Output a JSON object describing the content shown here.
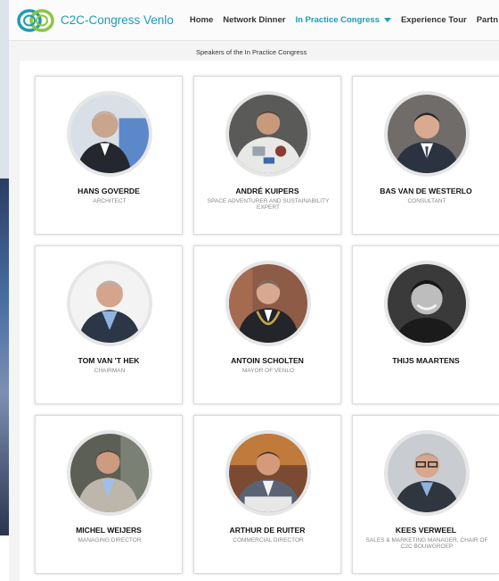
{
  "header": {
    "brand": "C2C-Congress Venlo",
    "nav": [
      {
        "label": "Home"
      },
      {
        "label": "Network Dinner"
      },
      {
        "label": "In Practice Congress"
      },
      {
        "label": "Experience Tour"
      },
      {
        "label": "Partn"
      }
    ]
  },
  "page": {
    "subheading": "Speakers of the In Practice Congress"
  },
  "speakers": [
    {
      "name": "HANS GOVERDE",
      "role": "ARCHITECT"
    },
    {
      "name": "ANDRÉ KUIPERS",
      "role": "SPACE ADVENTURER AND SUSTAINABILITY EXPERT"
    },
    {
      "name": "BAS VAN DE WESTERLO",
      "role": "CONSULTANT"
    },
    {
      "name": "TOM VAN 'T HEK",
      "role": "CHAIRMAN"
    },
    {
      "name": "ANTOIN SCHOLTEN",
      "role": "MAYOR OF VENLO"
    },
    {
      "name": "THIJS MAARTENS",
      "role": ""
    },
    {
      "name": "MICHEL WEIJERS",
      "role": "MANAGING DIRECTOR"
    },
    {
      "name": "ARTHUR DE RUITER",
      "role": "COMMERCIAL DIRECTOR"
    },
    {
      "name": "KEES VERWEEL",
      "role": "SALES & MARKETING MANAGER, CHAIR OF C2C BOUWGROEP"
    }
  ],
  "colors": {
    "accent": "#1e9bb8",
    "logo_green": "#8cc63f"
  }
}
